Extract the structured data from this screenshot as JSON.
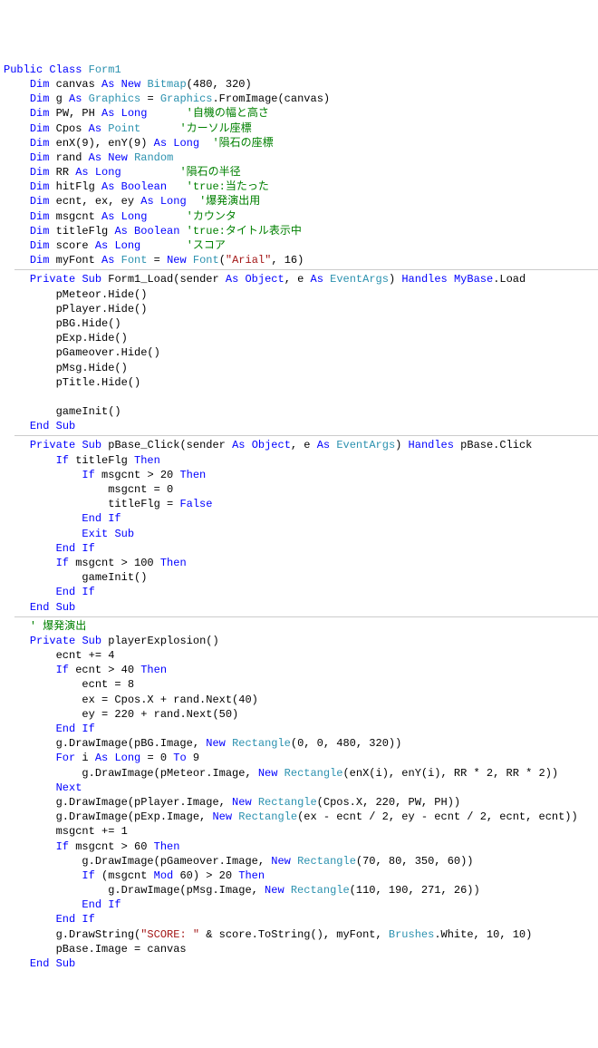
{
  "lines": [
    {
      "indent": 0,
      "segs": [
        {
          "t": "Public",
          "c": "kw"
        },
        {
          "t": " "
        },
        {
          "t": "Class",
          "c": "kw"
        },
        {
          "t": " "
        },
        {
          "t": "Form1",
          "c": "typ"
        }
      ]
    },
    {
      "indent": 1,
      "segs": [
        {
          "t": "Dim",
          "c": "kw"
        },
        {
          "t": " canvas "
        },
        {
          "t": "As",
          "c": "kw"
        },
        {
          "t": " "
        },
        {
          "t": "New",
          "c": "kw"
        },
        {
          "t": " "
        },
        {
          "t": "Bitmap",
          "c": "typ"
        },
        {
          "t": "(480, 320)"
        }
      ]
    },
    {
      "indent": 1,
      "segs": [
        {
          "t": "Dim",
          "c": "kw"
        },
        {
          "t": " g "
        },
        {
          "t": "As",
          "c": "kw"
        },
        {
          "t": " "
        },
        {
          "t": "Graphics",
          "c": "typ"
        },
        {
          "t": " = "
        },
        {
          "t": "Graphics",
          "c": "typ"
        },
        {
          "t": ".FromImage(canvas)"
        }
      ]
    },
    {
      "indent": 1,
      "segs": [
        {
          "t": "Dim",
          "c": "kw"
        },
        {
          "t": " PW, PH "
        },
        {
          "t": "As",
          "c": "kw"
        },
        {
          "t": " "
        },
        {
          "t": "Long",
          "c": "kw"
        },
        {
          "t": "      "
        },
        {
          "t": "'自機の幅と高さ",
          "c": "cmt"
        }
      ]
    },
    {
      "indent": 1,
      "segs": [
        {
          "t": "Dim",
          "c": "kw"
        },
        {
          "t": " Cpos "
        },
        {
          "t": "As",
          "c": "kw"
        },
        {
          "t": " "
        },
        {
          "t": "Point",
          "c": "typ"
        },
        {
          "t": "      "
        },
        {
          "t": "'カーソル座標",
          "c": "cmt"
        }
      ]
    },
    {
      "indent": 1,
      "segs": [
        {
          "t": "Dim",
          "c": "kw"
        },
        {
          "t": " enX(9), enY(9) "
        },
        {
          "t": "As",
          "c": "kw"
        },
        {
          "t": " "
        },
        {
          "t": "Long",
          "c": "kw"
        },
        {
          "t": "  "
        },
        {
          "t": "'隕石の座標",
          "c": "cmt"
        }
      ]
    },
    {
      "indent": 1,
      "segs": [
        {
          "t": "Dim",
          "c": "kw"
        },
        {
          "t": " rand "
        },
        {
          "t": "As",
          "c": "kw"
        },
        {
          "t": " "
        },
        {
          "t": "New",
          "c": "kw"
        },
        {
          "t": " "
        },
        {
          "t": "Random",
          "c": "typ"
        }
      ]
    },
    {
      "indent": 1,
      "segs": [
        {
          "t": "Dim",
          "c": "kw"
        },
        {
          "t": " RR "
        },
        {
          "t": "As",
          "c": "kw"
        },
        {
          "t": " "
        },
        {
          "t": "Long",
          "c": "kw"
        },
        {
          "t": "         "
        },
        {
          "t": "'隕石の半径",
          "c": "cmt"
        }
      ]
    },
    {
      "indent": 1,
      "segs": [
        {
          "t": "Dim",
          "c": "kw"
        },
        {
          "t": " hitFlg "
        },
        {
          "t": "As",
          "c": "kw"
        },
        {
          "t": " "
        },
        {
          "t": "Boolean",
          "c": "kw"
        },
        {
          "t": "   "
        },
        {
          "t": "'true:当たった",
          "c": "cmt"
        }
      ]
    },
    {
      "indent": 1,
      "segs": [
        {
          "t": "Dim",
          "c": "kw"
        },
        {
          "t": " ecnt, ex, ey "
        },
        {
          "t": "As",
          "c": "kw"
        },
        {
          "t": " "
        },
        {
          "t": "Long",
          "c": "kw"
        },
        {
          "t": "  "
        },
        {
          "t": "'爆発演出用",
          "c": "cmt"
        }
      ]
    },
    {
      "indent": 1,
      "segs": [
        {
          "t": "Dim",
          "c": "kw"
        },
        {
          "t": " msgcnt "
        },
        {
          "t": "As",
          "c": "kw"
        },
        {
          "t": " "
        },
        {
          "t": "Long",
          "c": "kw"
        },
        {
          "t": "      "
        },
        {
          "t": "'カウンタ",
          "c": "cmt"
        }
      ]
    },
    {
      "indent": 1,
      "segs": [
        {
          "t": "Dim",
          "c": "kw"
        },
        {
          "t": " titleFlg "
        },
        {
          "t": "As",
          "c": "kw"
        },
        {
          "t": " "
        },
        {
          "t": "Boolean",
          "c": "kw"
        },
        {
          "t": " "
        },
        {
          "t": "'true:タイトル表示中",
          "c": "cmt"
        }
      ]
    },
    {
      "indent": 1,
      "segs": [
        {
          "t": "Dim",
          "c": "kw"
        },
        {
          "t": " score "
        },
        {
          "t": "As",
          "c": "kw"
        },
        {
          "t": " "
        },
        {
          "t": "Long",
          "c": "kw"
        },
        {
          "t": "       "
        },
        {
          "t": "'スコア",
          "c": "cmt"
        }
      ]
    },
    {
      "indent": 1,
      "segs": [
        {
          "t": "Dim",
          "c": "kw"
        },
        {
          "t": " myFont "
        },
        {
          "t": "As",
          "c": "kw"
        },
        {
          "t": " "
        },
        {
          "t": "Font",
          "c": "typ"
        },
        {
          "t": " = "
        },
        {
          "t": "New",
          "c": "kw"
        },
        {
          "t": " "
        },
        {
          "t": "Font",
          "c": "typ"
        },
        {
          "t": "("
        },
        {
          "t": "\"Arial\"",
          "c": "str"
        },
        {
          "t": ", 16)"
        }
      ]
    },
    {
      "hr": true
    },
    {
      "indent": 1,
      "segs": [
        {
          "t": "Private",
          "c": "kw"
        },
        {
          "t": " "
        },
        {
          "t": "Sub",
          "c": "kw"
        },
        {
          "t": " Form1_Load(sender "
        },
        {
          "t": "As",
          "c": "kw"
        },
        {
          "t": " "
        },
        {
          "t": "Object",
          "c": "kw"
        },
        {
          "t": ", e "
        },
        {
          "t": "As",
          "c": "kw"
        },
        {
          "t": " "
        },
        {
          "t": "EventArgs",
          "c": "typ"
        },
        {
          "t": ") "
        },
        {
          "t": "Handles",
          "c": "kw"
        },
        {
          "t": " "
        },
        {
          "t": "MyBase",
          "c": "kw"
        },
        {
          "t": ".Load"
        }
      ]
    },
    {
      "indent": 2,
      "segs": [
        {
          "t": "pMeteor.Hide()"
        }
      ]
    },
    {
      "indent": 2,
      "segs": [
        {
          "t": "pPlayer.Hide()"
        }
      ]
    },
    {
      "indent": 2,
      "segs": [
        {
          "t": "pBG.Hide()"
        }
      ]
    },
    {
      "indent": 2,
      "segs": [
        {
          "t": "pExp.Hide()"
        }
      ]
    },
    {
      "indent": 2,
      "segs": [
        {
          "t": "pGameover.Hide()"
        }
      ]
    },
    {
      "indent": 2,
      "segs": [
        {
          "t": "pMsg.Hide()"
        }
      ]
    },
    {
      "indent": 2,
      "segs": [
        {
          "t": "pTitle.Hide()"
        }
      ]
    },
    {
      "indent": 2,
      "segs": [
        {
          "t": ""
        }
      ]
    },
    {
      "indent": 2,
      "segs": [
        {
          "t": "gameInit()"
        }
      ]
    },
    {
      "indent": 1,
      "segs": [
        {
          "t": "End",
          "c": "kw"
        },
        {
          "t": " "
        },
        {
          "t": "Sub",
          "c": "kw"
        }
      ]
    },
    {
      "hr": true
    },
    {
      "indent": 1,
      "segs": [
        {
          "t": "Private",
          "c": "kw"
        },
        {
          "t": " "
        },
        {
          "t": "Sub",
          "c": "kw"
        },
        {
          "t": " pBase_Click(sender "
        },
        {
          "t": "As",
          "c": "kw"
        },
        {
          "t": " "
        },
        {
          "t": "Object",
          "c": "kw"
        },
        {
          "t": ", e "
        },
        {
          "t": "As",
          "c": "kw"
        },
        {
          "t": " "
        },
        {
          "t": "EventArgs",
          "c": "typ"
        },
        {
          "t": ") "
        },
        {
          "t": "Handles",
          "c": "kw"
        },
        {
          "t": " pBase.Click"
        }
      ]
    },
    {
      "indent": 2,
      "segs": [
        {
          "t": "If",
          "c": "kw"
        },
        {
          "t": " titleFlg "
        },
        {
          "t": "Then",
          "c": "kw"
        }
      ]
    },
    {
      "indent": 3,
      "segs": [
        {
          "t": "If",
          "c": "kw"
        },
        {
          "t": " msgcnt > 20 "
        },
        {
          "t": "Then",
          "c": "kw"
        }
      ]
    },
    {
      "indent": 4,
      "segs": [
        {
          "t": "msgcnt = 0"
        }
      ]
    },
    {
      "indent": 4,
      "segs": [
        {
          "t": "titleFlg = "
        },
        {
          "t": "False",
          "c": "kw"
        }
      ]
    },
    {
      "indent": 3,
      "segs": [
        {
          "t": "End",
          "c": "kw"
        },
        {
          "t": " "
        },
        {
          "t": "If",
          "c": "kw"
        }
      ]
    },
    {
      "indent": 3,
      "segs": [
        {
          "t": "Exit",
          "c": "kw"
        },
        {
          "t": " "
        },
        {
          "t": "Sub",
          "c": "kw"
        }
      ]
    },
    {
      "indent": 2,
      "segs": [
        {
          "t": "End",
          "c": "kw"
        },
        {
          "t": " "
        },
        {
          "t": "If",
          "c": "kw"
        }
      ]
    },
    {
      "indent": 2,
      "segs": [
        {
          "t": "If",
          "c": "kw"
        },
        {
          "t": " msgcnt > 100 "
        },
        {
          "t": "Then",
          "c": "kw"
        }
      ]
    },
    {
      "indent": 3,
      "segs": [
        {
          "t": "gameInit()"
        }
      ]
    },
    {
      "indent": 2,
      "segs": [
        {
          "t": "End",
          "c": "kw"
        },
        {
          "t": " "
        },
        {
          "t": "If",
          "c": "kw"
        }
      ]
    },
    {
      "indent": 1,
      "segs": [
        {
          "t": "End",
          "c": "kw"
        },
        {
          "t": " "
        },
        {
          "t": "Sub",
          "c": "kw"
        }
      ]
    },
    {
      "hr": true
    },
    {
      "indent": 1,
      "segs": [
        {
          "t": "' 爆発演出",
          "c": "cmt"
        }
      ]
    },
    {
      "indent": 1,
      "segs": [
        {
          "t": "Private",
          "c": "kw"
        },
        {
          "t": " "
        },
        {
          "t": "Sub",
          "c": "kw"
        },
        {
          "t": " playerExplosion()"
        }
      ]
    },
    {
      "indent": 2,
      "segs": [
        {
          "t": "ecnt += 4"
        }
      ]
    },
    {
      "indent": 2,
      "segs": [
        {
          "t": "If",
          "c": "kw"
        },
        {
          "t": " ecnt > 40 "
        },
        {
          "t": "Then",
          "c": "kw"
        }
      ]
    },
    {
      "indent": 3,
      "segs": [
        {
          "t": "ecnt = 8"
        }
      ]
    },
    {
      "indent": 3,
      "segs": [
        {
          "t": "ex = Cpos.X + rand.Next(40)"
        }
      ]
    },
    {
      "indent": 3,
      "segs": [
        {
          "t": "ey = 220 + rand.Next(50)"
        }
      ]
    },
    {
      "indent": 2,
      "segs": [
        {
          "t": "End",
          "c": "kw"
        },
        {
          "t": " "
        },
        {
          "t": "If",
          "c": "kw"
        }
      ]
    },
    {
      "indent": 2,
      "segs": [
        {
          "t": "g.DrawImage(pBG.Image, "
        },
        {
          "t": "New",
          "c": "kw"
        },
        {
          "t": " "
        },
        {
          "t": "Rectangle",
          "c": "typ"
        },
        {
          "t": "(0, 0, 480, 320))"
        }
      ]
    },
    {
      "indent": 2,
      "segs": [
        {
          "t": "For",
          "c": "kw"
        },
        {
          "t": " i "
        },
        {
          "t": "As",
          "c": "kw"
        },
        {
          "t": " "
        },
        {
          "t": "Long",
          "c": "kw"
        },
        {
          "t": " = 0 "
        },
        {
          "t": "To",
          "c": "kw"
        },
        {
          "t": " 9"
        }
      ]
    },
    {
      "indent": 3,
      "segs": [
        {
          "t": "g.DrawImage(pMeteor.Image, "
        },
        {
          "t": "New",
          "c": "kw"
        },
        {
          "t": " "
        },
        {
          "t": "Rectangle",
          "c": "typ"
        },
        {
          "t": "(enX(i), enY(i), RR * 2, RR * 2))"
        }
      ]
    },
    {
      "indent": 2,
      "segs": [
        {
          "t": "Next",
          "c": "kw"
        }
      ]
    },
    {
      "indent": 2,
      "segs": [
        {
          "t": "g.DrawImage(pPlayer.Image, "
        },
        {
          "t": "New",
          "c": "kw"
        },
        {
          "t": " "
        },
        {
          "t": "Rectangle",
          "c": "typ"
        },
        {
          "t": "(Cpos.X, 220, PW, PH))"
        }
      ]
    },
    {
      "indent": 2,
      "segs": [
        {
          "t": "g.DrawImage(pExp.Image, "
        },
        {
          "t": "New",
          "c": "kw"
        },
        {
          "t": " "
        },
        {
          "t": "Rectangle",
          "c": "typ"
        },
        {
          "t": "(ex - ecnt / 2, ey - ecnt / 2, ecnt, ecnt))"
        }
      ]
    },
    {
      "indent": 2,
      "segs": [
        {
          "t": "msgcnt += 1"
        }
      ]
    },
    {
      "indent": 2,
      "segs": [
        {
          "t": "If",
          "c": "kw"
        },
        {
          "t": " msgcnt > 60 "
        },
        {
          "t": "Then",
          "c": "kw"
        }
      ]
    },
    {
      "indent": 3,
      "segs": [
        {
          "t": "g.DrawImage(pGameover.Image, "
        },
        {
          "t": "New",
          "c": "kw"
        },
        {
          "t": " "
        },
        {
          "t": "Rectangle",
          "c": "typ"
        },
        {
          "t": "(70, 80, 350, 60))"
        }
      ]
    },
    {
      "indent": 3,
      "segs": [
        {
          "t": "If",
          "c": "kw"
        },
        {
          "t": " (msgcnt "
        },
        {
          "t": "Mod",
          "c": "kw"
        },
        {
          "t": " 60) > 20 "
        },
        {
          "t": "Then",
          "c": "kw"
        }
      ]
    },
    {
      "indent": 4,
      "segs": [
        {
          "t": "g.DrawImage(pMsg.Image, "
        },
        {
          "t": "New",
          "c": "kw"
        },
        {
          "t": " "
        },
        {
          "t": "Rectangle",
          "c": "typ"
        },
        {
          "t": "(110, 190, 271, 26))"
        }
      ]
    },
    {
      "indent": 3,
      "segs": [
        {
          "t": "End",
          "c": "kw"
        },
        {
          "t": " "
        },
        {
          "t": "If",
          "c": "kw"
        }
      ]
    },
    {
      "indent": 2,
      "segs": [
        {
          "t": "End",
          "c": "kw"
        },
        {
          "t": " "
        },
        {
          "t": "If",
          "c": "kw"
        }
      ]
    },
    {
      "indent": 2,
      "segs": [
        {
          "t": "g.DrawString("
        },
        {
          "t": "\"SCORE: \"",
          "c": "str"
        },
        {
          "t": " & score.ToString(), myFont, "
        },
        {
          "t": "Brushes",
          "c": "typ"
        },
        {
          "t": ".White, 10, 10)"
        }
      ]
    },
    {
      "indent": 2,
      "segs": [
        {
          "t": "pBase.Image = canvas"
        }
      ]
    },
    {
      "indent": 1,
      "segs": [
        {
          "t": "End",
          "c": "kw"
        },
        {
          "t": " "
        },
        {
          "t": "Sub",
          "c": "kw"
        }
      ]
    }
  ],
  "indent_unit": "    "
}
